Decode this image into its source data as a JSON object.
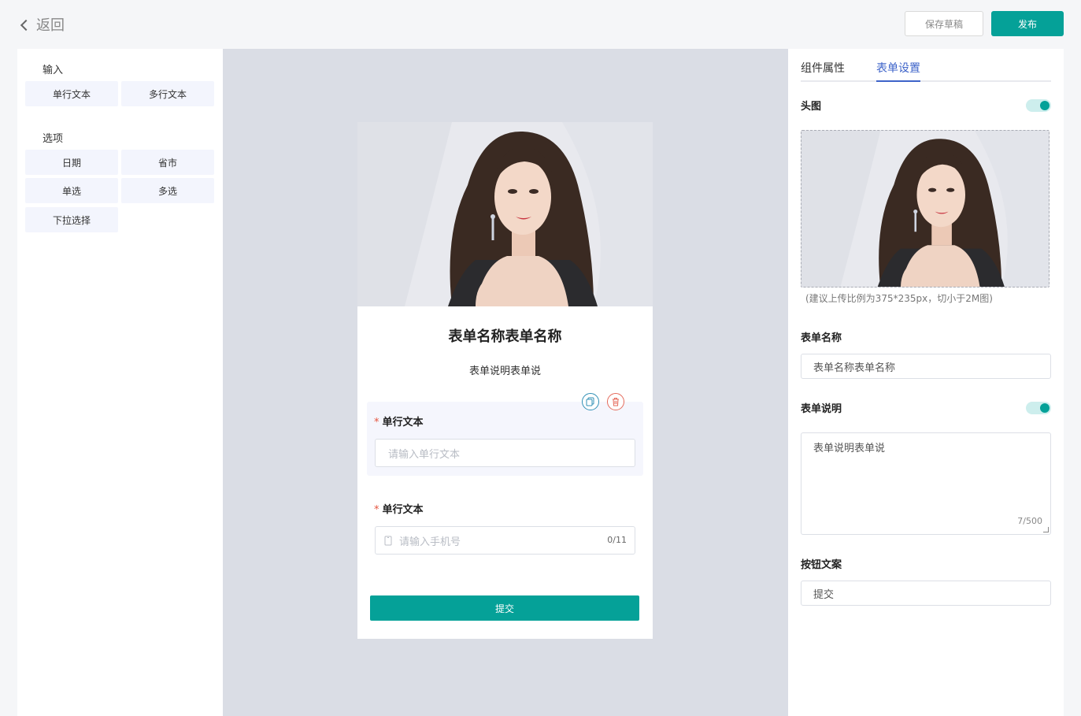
{
  "topbar": {
    "back_label": "返回",
    "draft_label": "保存草稿",
    "publish_label": "发布"
  },
  "palette": {
    "groups": [
      {
        "title": "输入",
        "items": [
          "单行文本",
          "多行文本"
        ]
      },
      {
        "title": "选项",
        "items": [
          "日期",
          "省市",
          "单选",
          "多选",
          "下拉选择"
        ]
      }
    ]
  },
  "preview": {
    "form_title": "表单名称表单名称",
    "form_desc": "表单说明表单说",
    "fields": [
      {
        "required_mark": "*",
        "label": "单行文本",
        "placeholder": "请输入单行文本"
      },
      {
        "required_mark": "*",
        "label": "单行文本",
        "placeholder": "请输入手机号",
        "counter": "0/11"
      }
    ],
    "submit_label": "提交"
  },
  "settings": {
    "tabs": [
      "组件属性",
      "表单设置"
    ],
    "active_tab": "表单设置",
    "header_image_label": "头图",
    "header_image_enabled": true,
    "upload_hint": "(建议上传比例为375*235px，切小于2M图)",
    "form_name_label": "表单名称",
    "form_name_value": "表单名称表单名称",
    "form_desc_label": "表单说明",
    "form_desc_enabled": true,
    "form_desc_value": "表单说明表单说",
    "form_desc_counter": "7/500",
    "button_text_label": "按钮文案",
    "button_text_value": "提交"
  },
  "colors": {
    "accent": "#05a198",
    "active_tab": "#3d63c9",
    "required": "#e5553f",
    "canvas_bg": "#dadde5"
  }
}
